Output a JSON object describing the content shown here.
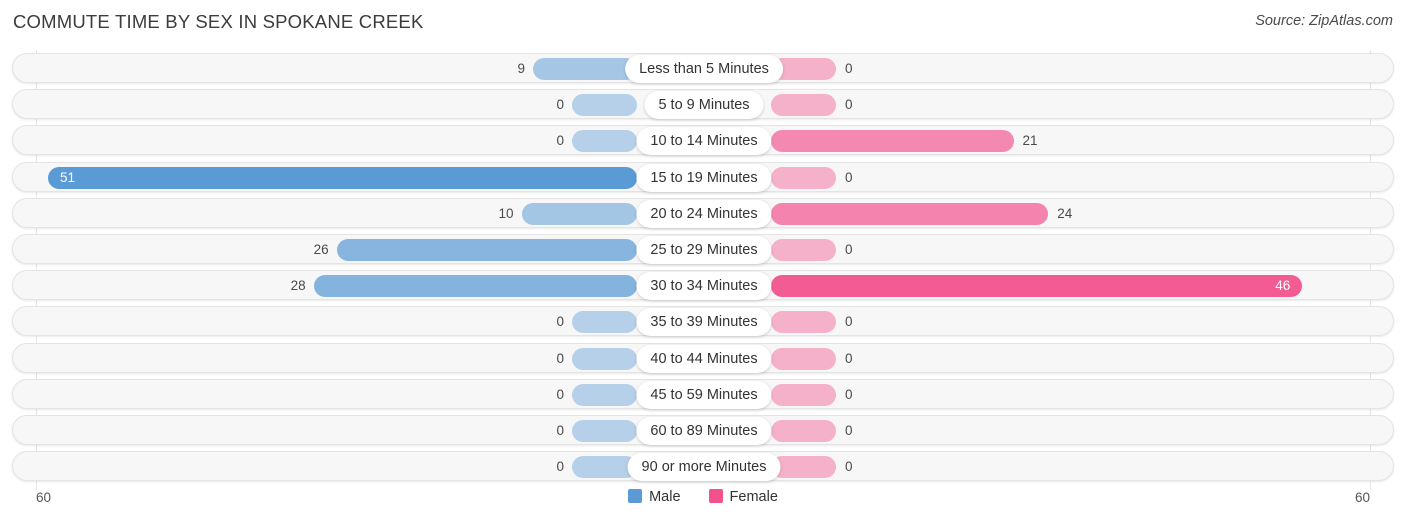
{
  "header": {
    "title": "COMMUTE TIME BY SEX IN SPOKANE CREEK",
    "source": "Source: ZipAtlas.com"
  },
  "legend": {
    "male_label": "Male",
    "female_label": "Female",
    "male_color": "#5b9bd5",
    "female_color": "#f2518c"
  },
  "axis": {
    "left_label": "60",
    "right_label": "60"
  },
  "chart_data": {
    "type": "bar",
    "title": "COMMUTE TIME BY SEX IN SPOKANE CREEK",
    "subtitle": "",
    "xlabel": "",
    "ylabel": "",
    "orientation": "horizontal-diverging",
    "grid": true,
    "legend_position": "bottom-center",
    "axis_max": 60,
    "xlim": [
      60,
      60
    ],
    "categories": [
      "Less than 5 Minutes",
      "5 to 9 Minutes",
      "10 to 14 Minutes",
      "15 to 19 Minutes",
      "20 to 24 Minutes",
      "25 to 29 Minutes",
      "30 to 34 Minutes",
      "35 to 39 Minutes",
      "40 to 44 Minutes",
      "45 to 59 Minutes",
      "60 to 89 Minutes",
      "90 or more Minutes"
    ],
    "series": [
      {
        "name": "Male",
        "color": "#5b9bd5",
        "side": "left",
        "values": [
          9,
          0,
          0,
          51,
          10,
          26,
          28,
          0,
          0,
          0,
          0,
          0
        ]
      },
      {
        "name": "Female",
        "color": "#f2518c",
        "side": "right",
        "values": [
          0,
          0,
          21,
          0,
          24,
          0,
          46,
          0,
          0,
          0,
          0,
          0
        ]
      }
    ]
  }
}
